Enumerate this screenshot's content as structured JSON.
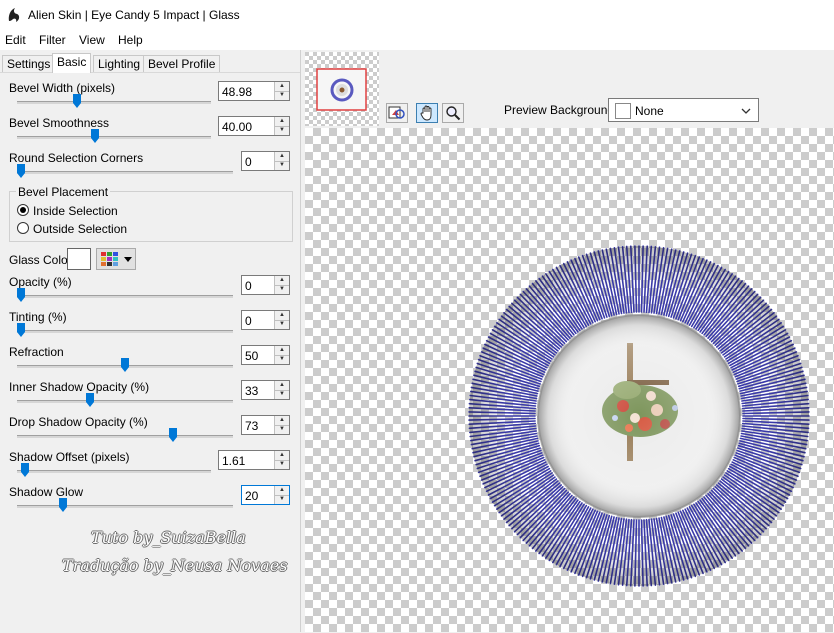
{
  "window": {
    "title": "Alien Skin | Eye Candy 5 Impact | Glass"
  },
  "menu": [
    "Edit",
    "Filter",
    "View",
    "Help"
  ],
  "tabs": [
    "Settings",
    "Basic",
    "Lighting",
    "Bevel Profile"
  ],
  "active_tab": "Basic",
  "params": {
    "bevel_width": {
      "label": "Bevel Width (pixels)",
      "value": "48.98",
      "level": 0.3
    },
    "bevel_smoothness": {
      "label": "Bevel Smoothness",
      "value": "40.00",
      "level": 0.4
    },
    "round_corners": {
      "label": "Round Selection Corners",
      "value": "0",
      "level": 0.0
    },
    "bevel_placement": {
      "title": "Bevel Placement",
      "options": [
        "Inside Selection",
        "Outside Selection"
      ],
      "selected": "Inside Selection"
    },
    "glass_color": {
      "label": "Glass Color",
      "color": "#ffffff"
    },
    "opacity": {
      "label": "Opacity (%)",
      "value": "0",
      "level": 0.0
    },
    "tinting": {
      "label": "Tinting (%)",
      "value": "0",
      "level": 0.0
    },
    "refraction": {
      "label": "Refraction",
      "value": "50",
      "level": 0.5
    },
    "inner_shadow": {
      "label": "Inner Shadow Opacity (%)",
      "value": "33",
      "level": 0.33
    },
    "drop_shadow": {
      "label": "Drop Shadow Opacity (%)",
      "value": "73",
      "level": 0.73
    },
    "shadow_offset": {
      "label": "Shadow Offset (pixels)",
      "value": "1.61",
      "level": 0.02
    },
    "shadow_glow": {
      "label": "Shadow Glow",
      "value": "20",
      "level": 0.2
    }
  },
  "watermark": {
    "line1": "Tuto by_SuizaBella",
    "line2": "Tradução by_Neusa Novaes"
  },
  "preview": {
    "background_label": "Preview Background:",
    "background_value": "None",
    "ray_color": "#3a3aa8"
  },
  "icons": [
    "app-logo-icon",
    "hand-pan-icon",
    "zoom-icon",
    "preview-compare-icon",
    "color-palette-icon",
    "dropdown-arrow-icon"
  ]
}
